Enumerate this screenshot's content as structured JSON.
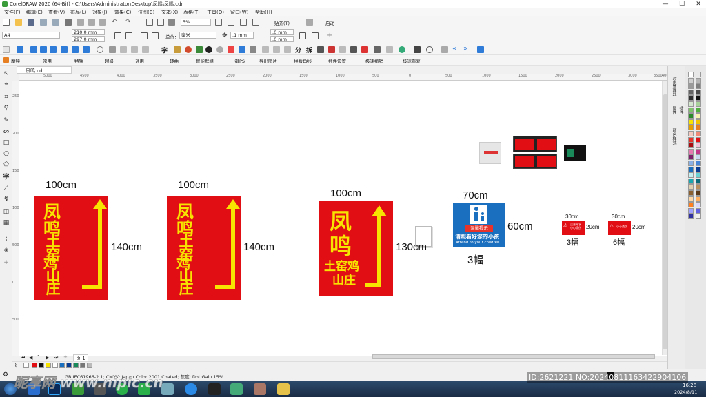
{
  "window": {
    "title": "CorelDRAW 2020 (64-Bit) - C:\\Users\\Administrator\\Desktop\\凤鸣\\凤鸣.cdr",
    "minimize": "—",
    "maximize": "☐",
    "close": "✕"
  },
  "menu": [
    "文件(F)",
    "编辑(E)",
    "查看(V)",
    "布局(L)",
    "对象(J)",
    "效果(C)",
    "位图(B)",
    "文本(X)",
    "表格(T)",
    "工具(O)",
    "窗口(W)",
    "帮助(H)"
  ],
  "toolbar_standard": {
    "zoom": "5%",
    "snap_label": "贴齐(T)",
    "launch_label": "启动"
  },
  "property_bar": {
    "page_size": "A4",
    "width": "210.0 mm",
    "height": "297.0 mm",
    "units_label": "单位：",
    "units_value": "毫米",
    "nudge": ".1 mm",
    "dup_x": ".0 mm",
    "dup_y": ".0 mm"
  },
  "plugin_bar": {
    "items": [
      "魔镜",
      "常用",
      "特殊",
      "超级",
      "通用",
      "转曲",
      "智能群组",
      "一键PS",
      "导出图片",
      "拼版角线",
      "插件设置",
      "极速撤销",
      "极速重复"
    ]
  },
  "document_tab": "凤鸣.cdr",
  "ruler_top_labels": [
    "5000",
    "4500",
    "4000",
    "3500",
    "3000",
    "2500",
    "2000",
    "1500",
    "1000",
    "500",
    "0",
    "500",
    "1000",
    "1500",
    "2000",
    "2500",
    "3000",
    "3500",
    "4000"
  ],
  "ruler_left_labels": [
    "2500",
    "2000",
    "1500",
    "1000",
    "500",
    "0",
    "500"
  ],
  "signs": [
    {
      "line1": "凤",
      "line2": "鸣",
      "line3": "土窑",
      "line4": "鸡",
      "line5": "山庄",
      "width_label": "100cm",
      "height_label": "140cm"
    },
    {
      "line1": "凤",
      "line2": "鸣",
      "line3": "土窑",
      "line4": "鸡",
      "line5": "山庄",
      "width_label": "100cm",
      "height_label": "140cm"
    },
    {
      "line1": "凤",
      "line2": "鸣",
      "line3": "土窑鸡",
      "line4": "山庄",
      "width_label": "100cm",
      "height_label": "130cm"
    }
  ],
  "child_sign": {
    "tag": "温馨提示",
    "cn_text": "请照看好您的小孩",
    "en_text": "Attend to your children",
    "width_label": "70cm",
    "height_label": "60cm",
    "count_label": "3幅"
  },
  "small_signs": [
    {
      "text": "注意开水 小心烫伤",
      "width_label": "30cm",
      "height_label": "20cm",
      "count_label": "3幅"
    },
    {
      "text": "小心烫伤",
      "width_label": "30cm",
      "height_label": "20cm",
      "count_label": "6幅"
    }
  ],
  "docker_tabs": [
    "对象管理器",
    "属性",
    "插件",
    "颜色样式"
  ],
  "page_nav": {
    "page_label": "页 1",
    "page_count": "1"
  },
  "status": {
    "profile": "GB IEC61966-2.1; CMYK: Japan Color 2001 Coated; 灰度: Dot Gain 15%"
  },
  "watermark": {
    "site": "昵享网 www.nipic.cn",
    "id": "ID:2621221 NO:20240811163422904106"
  },
  "taskbar": {
    "time": "16:28",
    "date": "2024/8/11"
  },
  "colors": {
    "sign_red": "#e10e14",
    "sign_yellow": "#f7e400",
    "child_blue": "#1a6fbf"
  }
}
